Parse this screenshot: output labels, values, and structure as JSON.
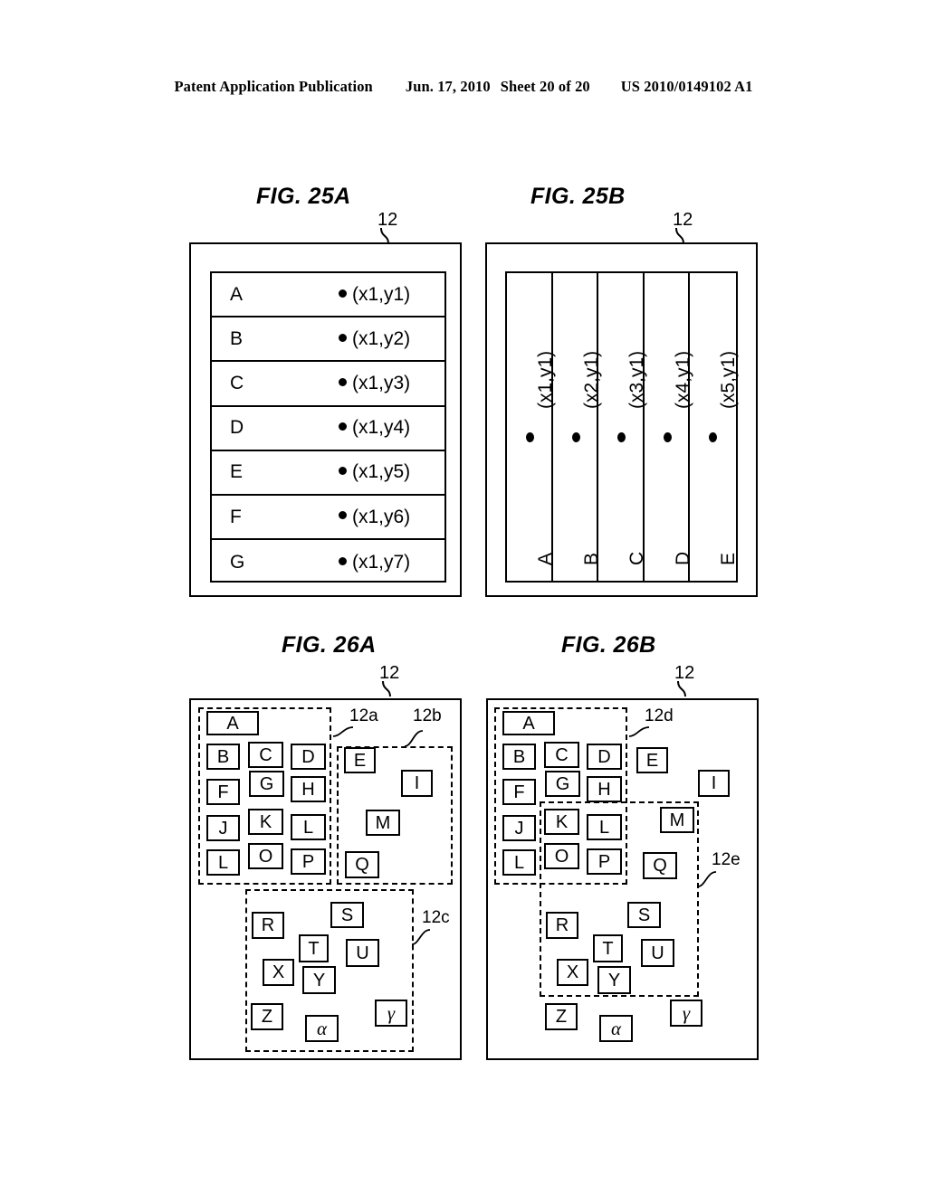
{
  "header": {
    "publication": "Patent Application Publication",
    "date": "Jun. 17, 2010",
    "sheet": "Sheet 20 of 20",
    "docnum": "US 2010/0149102 A1"
  },
  "figures": {
    "fig25a": {
      "title": "FIG. 25A",
      "refnum": "12",
      "rows": [
        {
          "label": "A",
          "coord": "(x1,y1)"
        },
        {
          "label": "B",
          "coord": "(x1,y2)"
        },
        {
          "label": "C",
          "coord": "(x1,y3)"
        },
        {
          "label": "D",
          "coord": "(x1,y4)"
        },
        {
          "label": "E",
          "coord": "(x1,y5)"
        },
        {
          "label": "F",
          "coord": "(x1,y6)"
        },
        {
          "label": "G",
          "coord": "(x1,y7)"
        }
      ]
    },
    "fig25b": {
      "title": "FIG. 25B",
      "refnum": "12",
      "columns": [
        {
          "label": "A",
          "coord": "(x1,y1)"
        },
        {
          "label": "B",
          "coord": "(x2,y1)"
        },
        {
          "label": "C",
          "coord": "(x3,y1)"
        },
        {
          "label": "D",
          "coord": "(x4,y1)"
        },
        {
          "label": "E",
          "coord": "(x5,y1)"
        }
      ]
    },
    "fig26a": {
      "title": "FIG. 26A",
      "refnum": "12",
      "regions": [
        {
          "id": "12a",
          "label": "12a"
        },
        {
          "id": "12b",
          "label": "12b"
        },
        {
          "id": "12c",
          "label": "12c"
        }
      ],
      "boxes": [
        {
          "label": "A"
        },
        {
          "label": "B"
        },
        {
          "label": "C"
        },
        {
          "label": "D"
        },
        {
          "label": "E"
        },
        {
          "label": "F"
        },
        {
          "label": "G"
        },
        {
          "label": "H"
        },
        {
          "label": "I"
        },
        {
          "label": "J"
        },
        {
          "label": "K"
        },
        {
          "label": "L"
        },
        {
          "label": "L"
        },
        {
          "label": "M"
        },
        {
          "label": "O"
        },
        {
          "label": "P"
        },
        {
          "label": "Q"
        },
        {
          "label": "R"
        },
        {
          "label": "S"
        },
        {
          "label": "T"
        },
        {
          "label": "U"
        },
        {
          "label": "X"
        },
        {
          "label": "Y"
        },
        {
          "label": "Z"
        },
        {
          "label": "α"
        },
        {
          "label": "γ"
        }
      ]
    },
    "fig26b": {
      "title": "FIG. 26B",
      "refnum": "12",
      "regions": [
        {
          "id": "12d",
          "label": "12d"
        },
        {
          "id": "12e",
          "label": "12e"
        }
      ],
      "boxes": [
        {
          "label": "A"
        },
        {
          "label": "B"
        },
        {
          "label": "C"
        },
        {
          "label": "D"
        },
        {
          "label": "E"
        },
        {
          "label": "F"
        },
        {
          "label": "G"
        },
        {
          "label": "H"
        },
        {
          "label": "I"
        },
        {
          "label": "J"
        },
        {
          "label": "K"
        },
        {
          "label": "L"
        },
        {
          "label": "L"
        },
        {
          "label": "M"
        },
        {
          "label": "O"
        },
        {
          "label": "P"
        },
        {
          "label": "Q"
        },
        {
          "label": "R"
        },
        {
          "label": "S"
        },
        {
          "label": "T"
        },
        {
          "label": "U"
        },
        {
          "label": "X"
        },
        {
          "label": "Y"
        },
        {
          "label": "Z"
        },
        {
          "label": "α"
        },
        {
          "label": "γ"
        }
      ]
    }
  },
  "colors": {
    "ink": "#000000",
    "paper": "#ffffff"
  }
}
